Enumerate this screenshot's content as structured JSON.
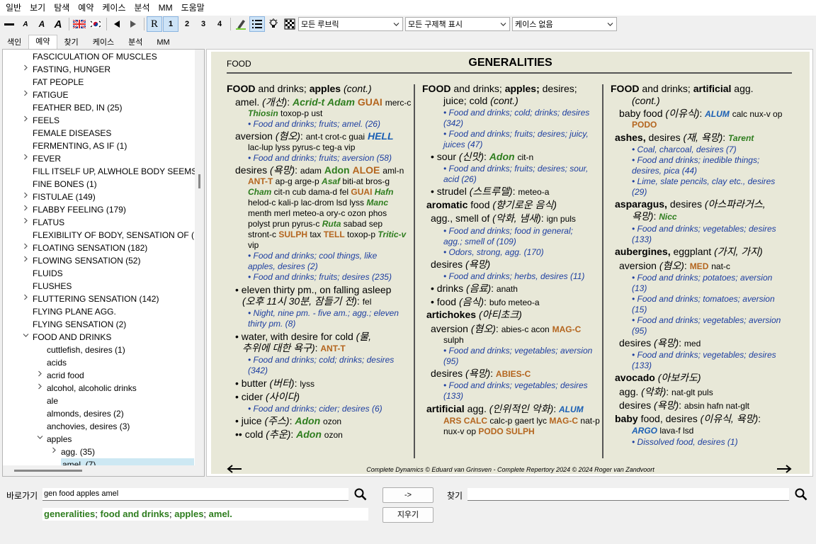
{
  "menu": [
    "일반",
    "보기",
    "탐색",
    "예약",
    "케이스",
    "분석",
    "MM",
    "도움말"
  ],
  "toolbar": {
    "rep_label": "R",
    "rep_num1": "1",
    "rep_num2": "2",
    "rep_num3": "3",
    "rep_num4": "4",
    "rubric_combo": "모든 루브릭",
    "remedy_combo": "모든 구제책 표시",
    "case_combo": "케이스 없음"
  },
  "tabs": [
    "색인",
    "예약",
    "찾기",
    "케이스",
    "분석",
    "MM"
  ],
  "tree": [
    {
      "label": "FASCICULATION OF MUSCLES",
      "arrow": false
    },
    {
      "label": "FASTING, HUNGER",
      "arrow": true
    },
    {
      "label": "FAT PEOPLE",
      "arrow": false
    },
    {
      "label": "FATIGUE",
      "arrow": true
    },
    {
      "label": "FEATHER BED, IN (25)",
      "arrow": false
    },
    {
      "label": "FEELS",
      "arrow": true
    },
    {
      "label": "FEMALE DISEASES",
      "arrow": false
    },
    {
      "label": "FERMENTING, AS IF (1)",
      "arrow": false
    },
    {
      "label": "FEVER",
      "arrow": true
    },
    {
      "label": "FILL ITSELF UP, ALWHOLE BODY SEEMS T",
      "arrow": false
    },
    {
      "label": "FINE BONES (1)",
      "arrow": false
    },
    {
      "label": "FISTULAE (149)",
      "arrow": true
    },
    {
      "label": "FLABBY FEELING (179)",
      "arrow": true
    },
    {
      "label": "FLATUS",
      "arrow": true
    },
    {
      "label": "FLEXIBILITY OF BODY, SENSATION OF (",
      "arrow": false
    },
    {
      "label": "FLOATING SENSATION (182)",
      "arrow": true
    },
    {
      "label": "FLOWING SENSATION (52)",
      "arrow": true
    },
    {
      "label": "FLUIDS",
      "arrow": false
    },
    {
      "label": "FLUSHES",
      "arrow": false
    },
    {
      "label": "FLUTTERING SENSATION (142)",
      "arrow": true
    },
    {
      "label": "FLYING PLANE AGG.",
      "arrow": false
    },
    {
      "label": "FLYING SENSATION (2)",
      "arrow": false
    },
    {
      "label": "FOOD AND DRINKS",
      "arrow": "open"
    },
    {
      "label": "cuttlefish, desires (1)",
      "arrow": false,
      "indent": 1
    },
    {
      "label": "acids",
      "arrow": false,
      "indent": 1
    },
    {
      "label": "acrid food",
      "arrow": true,
      "indent": 1
    },
    {
      "label": "alcohol, alcoholic drinks",
      "arrow": true,
      "indent": 1
    },
    {
      "label": "ale",
      "arrow": false,
      "indent": 1
    },
    {
      "label": "almonds, desires (2)",
      "arrow": false,
      "indent": 1
    },
    {
      "label": "anchovies, desires (3)",
      "arrow": false,
      "indent": 1
    },
    {
      "label": "apples",
      "arrow": "open",
      "indent": 1
    },
    {
      "label": "agg. (35)",
      "arrow": true,
      "indent": 2
    },
    {
      "label": "amel. (7)",
      "arrow": false,
      "indent": 2,
      "selected": true
    }
  ],
  "doc": {
    "section": "FOOD",
    "title": "GENERALITIES",
    "footer": "Complete Dynamics © Eduard van Grinsven   -   Complete Repertory 2024 © 2024 Roger van Zandvoort"
  },
  "bottom": {
    "goto_label": "바로가기",
    "goto_value": "gen food apples amel",
    "arrow_btn": "->",
    "find_label": "찾기",
    "find_value": "",
    "clear_btn": "지우기",
    "result": [
      "generalities",
      "; ",
      "food and drinks",
      "; ",
      "apples",
      "; ",
      "amel."
    ]
  }
}
